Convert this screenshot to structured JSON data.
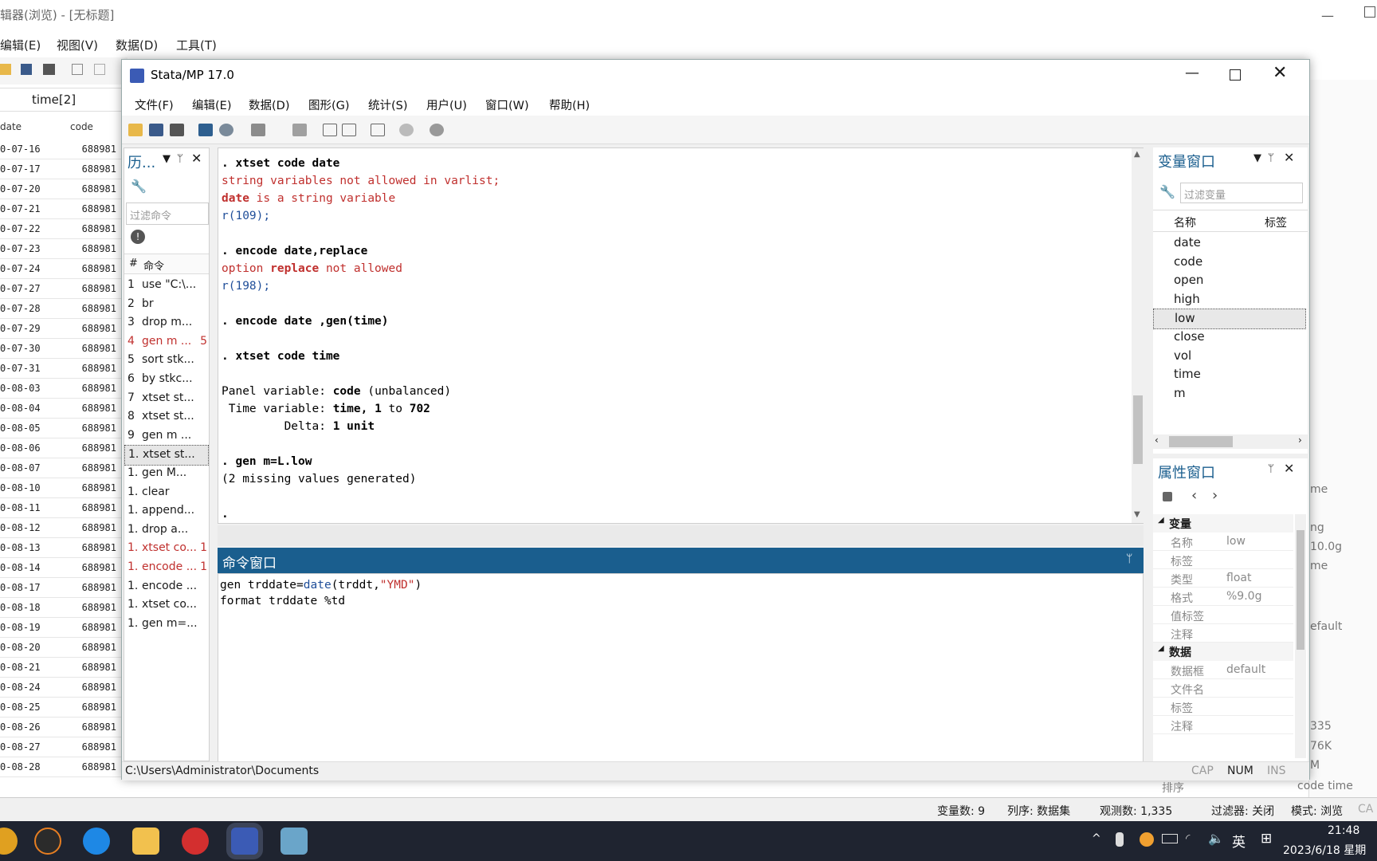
{
  "background_editor": {
    "title": "辑器(浏览) - [无标题]",
    "menu": [
      "编辑(E)",
      "视图(V)",
      "数据(D)",
      "工具(T)"
    ],
    "cell_ref": "time[2]",
    "col_date": "date",
    "col_code": "code",
    "rows": [
      {
        "date": "0-07-16",
        "code": "688981"
      },
      {
        "date": "0-07-17",
        "code": "688981"
      },
      {
        "date": "0-07-20",
        "code": "688981"
      },
      {
        "date": "0-07-21",
        "code": "688981"
      },
      {
        "date": "0-07-22",
        "code": "688981"
      },
      {
        "date": "0-07-23",
        "code": "688981"
      },
      {
        "date": "0-07-24",
        "code": "688981"
      },
      {
        "date": "0-07-27",
        "code": "688981"
      },
      {
        "date": "0-07-28",
        "code": "688981"
      },
      {
        "date": "0-07-29",
        "code": "688981"
      },
      {
        "date": "0-07-30",
        "code": "688981"
      },
      {
        "date": "0-07-31",
        "code": "688981"
      },
      {
        "date": "0-08-03",
        "code": "688981"
      },
      {
        "date": "0-08-04",
        "code": "688981"
      },
      {
        "date": "0-08-05",
        "code": "688981"
      },
      {
        "date": "0-08-06",
        "code": "688981"
      },
      {
        "date": "0-08-07",
        "code": "688981"
      },
      {
        "date": "0-08-10",
        "code": "688981"
      },
      {
        "date": "0-08-11",
        "code": "688981"
      },
      {
        "date": "0-08-12",
        "code": "688981"
      },
      {
        "date": "0-08-13",
        "code": "688981"
      },
      {
        "date": "0-08-14",
        "code": "688981"
      },
      {
        "date": "0-08-17",
        "code": "688981"
      },
      {
        "date": "0-08-18",
        "code": "688981"
      },
      {
        "date": "0-08-19",
        "code": "688981"
      },
      {
        "date": "0-08-20",
        "code": "688981"
      },
      {
        "date": "0-08-21",
        "code": "688981"
      },
      {
        "date": "0-08-24",
        "code": "688981"
      },
      {
        "date": "0-08-25",
        "code": "688981"
      },
      {
        "date": "0-08-26",
        "code": "688981"
      },
      {
        "date": "0-08-27",
        "code": "688981"
      },
      {
        "date": "0-08-28",
        "code": "688981"
      }
    ],
    "right_fragments": [
      "me",
      "ng",
      "10.0g",
      "me",
      "efault",
      "335",
      "76K",
      "M",
      "code time"
    ],
    "sort_label": "排序",
    "status": {
      "vars": "变量数: 9",
      "order": "列序: 数据集",
      "obs": "观测数: 1,335",
      "filter": "过滤器: 关闭",
      "mode": "模式: 浏览",
      "cap": "CA"
    }
  },
  "window": {
    "title": "Stata/MP 17.0",
    "menu": [
      "文件(F)",
      "编辑(E)",
      "数据(D)",
      "图形(G)",
      "统计(S)",
      "用户(U)",
      "窗口(W)",
      "帮助(H)"
    ]
  },
  "history": {
    "title": "历...",
    "filter_placeholder": "过滤命令",
    "col_num": "#",
    "col_cmd": "命令",
    "items": [
      {
        "n": "1",
        "cmd": "use \"C:\\...",
        "rc": "",
        "err": false,
        "sel": false
      },
      {
        "n": "2",
        "cmd": "br",
        "rc": "",
        "err": false,
        "sel": false
      },
      {
        "n": "3",
        "cmd": "drop m...",
        "rc": "",
        "err": false,
        "sel": false
      },
      {
        "n": "4",
        "cmd": "gen m ...",
        "rc": "5",
        "err": true,
        "sel": false
      },
      {
        "n": "5",
        "cmd": "sort stk...",
        "rc": "",
        "err": false,
        "sel": false
      },
      {
        "n": "6",
        "cmd": "by stkc...",
        "rc": "",
        "err": false,
        "sel": false
      },
      {
        "n": "7",
        "cmd": "xtset st...",
        "rc": "",
        "err": false,
        "sel": false
      },
      {
        "n": "8",
        "cmd": "xtset st...",
        "rc": "",
        "err": false,
        "sel": false
      },
      {
        "n": "9",
        "cmd": "gen m ...",
        "rc": "",
        "err": false,
        "sel": false
      },
      {
        "n": "1.",
        "cmd": "xtset st...",
        "rc": "",
        "err": false,
        "sel": true
      },
      {
        "n": "1.",
        "cmd": "gen M...",
        "rc": "",
        "err": false,
        "sel": false
      },
      {
        "n": "1.",
        "cmd": "clear",
        "rc": "",
        "err": false,
        "sel": false
      },
      {
        "n": "1.",
        "cmd": "append...",
        "rc": "",
        "err": false,
        "sel": false
      },
      {
        "n": "1.",
        "cmd": "drop a...",
        "rc": "",
        "err": false,
        "sel": false
      },
      {
        "n": "1.",
        "cmd": "xtset co...",
        "rc": "1",
        "err": true,
        "sel": false
      },
      {
        "n": "1.",
        "cmd": "encode ...",
        "rc": "1",
        "err": true,
        "sel": false
      },
      {
        "n": "1.",
        "cmd": "encode ...",
        "rc": "",
        "err": false,
        "sel": false
      },
      {
        "n": "1.",
        "cmd": "xtset co...",
        "rc": "",
        "err": false,
        "sel": false
      },
      {
        "n": "1.",
        "cmd": "gen m=...",
        "rc": "",
        "err": false,
        "sel": false
      }
    ]
  },
  "results": {
    "lines": [
      [
        {
          "t": ". xtset code date",
          "c": "b"
        }
      ],
      [
        {
          "t": "string variables not allowed in varlist;",
          "c": "r"
        }
      ],
      [
        {
          "t": "date",
          "c": "r b"
        },
        {
          "t": " is a string variable",
          "c": "r"
        }
      ],
      [
        {
          "t": "r(109);",
          "c": "bl"
        }
      ],
      [
        {
          "t": "",
          "c": ""
        }
      ],
      [
        {
          "t": ". encode date,replace",
          "c": "b"
        }
      ],
      [
        {
          "t": "option ",
          "c": "r"
        },
        {
          "t": "replace",
          "c": "r b"
        },
        {
          "t": " not allowed",
          "c": "r"
        }
      ],
      [
        {
          "t": "r(198);",
          "c": "bl"
        }
      ],
      [
        {
          "t": "",
          "c": ""
        }
      ],
      [
        {
          "t": ". encode date ,gen(time)",
          "c": "b"
        }
      ],
      [
        {
          "t": "",
          "c": ""
        }
      ],
      [
        {
          "t": ". xtset code time",
          "c": "b"
        }
      ],
      [
        {
          "t": "",
          "c": ""
        }
      ],
      [
        {
          "t": "Panel variable: ",
          "c": ""
        },
        {
          "t": "code",
          "c": "b"
        },
        {
          "t": " (unbalanced)",
          "c": ""
        }
      ],
      [
        {
          "t": " Time variable: ",
          "c": ""
        },
        {
          "t": "time, 1",
          "c": "b"
        },
        {
          "t": " to ",
          "c": ""
        },
        {
          "t": "702",
          "c": "b"
        }
      ],
      [
        {
          "t": "         Delta: ",
          "c": ""
        },
        {
          "t": "1 unit",
          "c": "b"
        }
      ],
      [
        {
          "t": "",
          "c": ""
        }
      ],
      [
        {
          "t": ". gen m=L.low",
          "c": "b"
        }
      ],
      [
        {
          "t": "(2 missing values generated)",
          "c": ""
        }
      ],
      [
        {
          "t": "",
          "c": ""
        }
      ],
      [
        {
          "t": ".",
          "c": "b"
        }
      ]
    ]
  },
  "command": {
    "title": "命令窗口",
    "lines": [
      [
        {
          "t": "gen trddate=",
          "c": ""
        },
        {
          "t": "date",
          "c": "bl"
        },
        {
          "t": "(trddt,",
          "c": ""
        },
        {
          "t": "\"YMD\"",
          "c": "r"
        },
        {
          "t": ")",
          "c": ""
        }
      ],
      [
        {
          "t": "format trddate %td",
          "c": ""
        }
      ]
    ]
  },
  "variables": {
    "title": "变量窗口",
    "filter_placeholder": "过滤变量",
    "col_name": "名称",
    "col_label": "标签",
    "items": [
      "date",
      "code",
      "open",
      "high",
      "low",
      "close",
      "vol",
      "time",
      "m"
    ],
    "selected": "low"
  },
  "properties": {
    "title": "属性窗口",
    "sections": [
      {
        "name": "变量",
        "rows": [
          {
            "k": "名称",
            "v": "low"
          },
          {
            "k": "标签",
            "v": ""
          },
          {
            "k": "类型",
            "v": "float"
          },
          {
            "k": "格式",
            "v": "%9.0g"
          },
          {
            "k": "值标签",
            "v": ""
          },
          {
            "k": "注释",
            "v": ""
          }
        ]
      },
      {
        "name": "数据",
        "rows": [
          {
            "k": "数据框",
            "v": "default"
          },
          {
            "k": "文件名",
            "v": ""
          },
          {
            "k": "标签",
            "v": ""
          },
          {
            "k": "注释",
            "v": ""
          }
        ]
      }
    ]
  },
  "statusbar": {
    "path": "C:\\Users\\Administrator\\Documents",
    "cap": "CAP",
    "num": "NUM",
    "ins": "INS"
  },
  "taskbar": {
    "time": "21:48",
    "date": "2023/6/18 星期",
    "ime": "英"
  }
}
